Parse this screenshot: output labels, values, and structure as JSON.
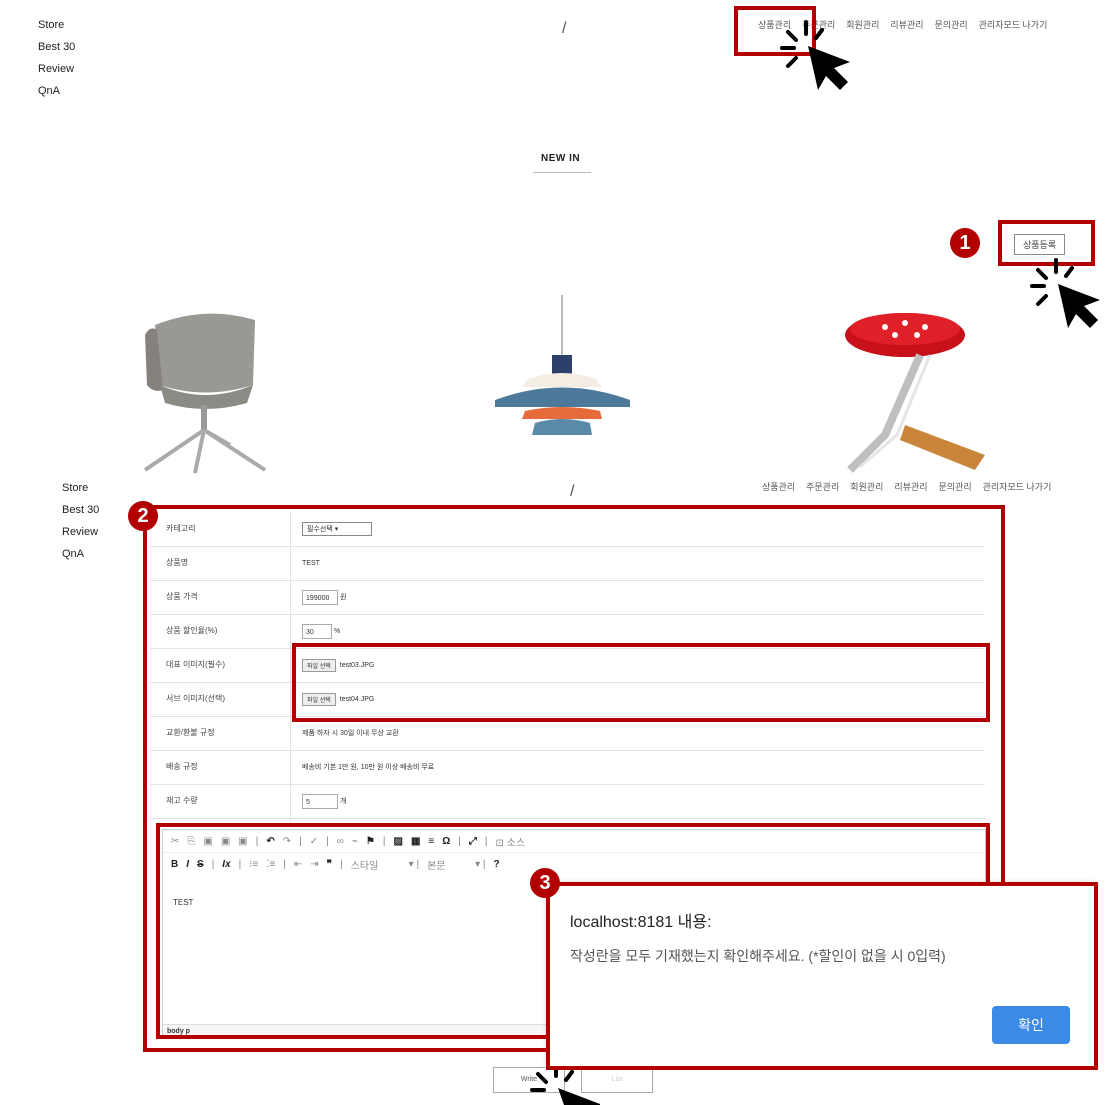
{
  "side_nav": [
    "Store",
    "Best 30",
    "Review",
    "QnA"
  ],
  "top_nav_1": [
    "상품관리",
    "주문관리",
    "회원관리",
    "리뷰관리",
    "문의관리",
    "관리자모드 나가기"
  ],
  "top_nav_2": [
    "상품관리",
    "주문관리",
    "회원관리",
    "리뷰관리",
    "문의관리",
    "관리자모드 나가기"
  ],
  "slash": "/",
  "section_title": "NEW IN",
  "register_button": "상품등록",
  "badges": [
    "1",
    "2",
    "3"
  ],
  "form": {
    "category": {
      "label": "카테고리",
      "value": "필수선택"
    },
    "name": {
      "label": "상품명",
      "value": "TEST"
    },
    "price": {
      "label": "상품 가격",
      "value": "199000",
      "unit": "원"
    },
    "discount": {
      "label": "상품 할인율(%)",
      "value": "30",
      "unit": "%"
    },
    "main_image": {
      "label": "대표 이미지(필수)",
      "button": "파일 선택",
      "file": "test03.JPG"
    },
    "sub_image": {
      "label": "서브 이미지(선택)",
      "button": "파일 선택",
      "file": "test04.JPG"
    },
    "refund": {
      "label": "교환/환불 규정",
      "value": "제품 하자 시 30일 이내 무상 교환"
    },
    "shipping": {
      "label": "배송 규정",
      "value": "배송비 기본 1만 원, 10만 원 이상 배송비 무료"
    },
    "stock": {
      "label": "재고 수량",
      "value": "5",
      "unit": "개"
    }
  },
  "editor": {
    "source_label": "소스",
    "style_label": "스타일",
    "format_label": "본문",
    "content": "TEST",
    "path": "body  p"
  },
  "dialog": {
    "title": "localhost:8181 내용:",
    "message": "작성란을 모두 기재했는지 확인해주세요. (*할인이 없을 시 0입력)",
    "ok": "확인"
  },
  "buttons": {
    "write": "Write",
    "list": "List"
  }
}
